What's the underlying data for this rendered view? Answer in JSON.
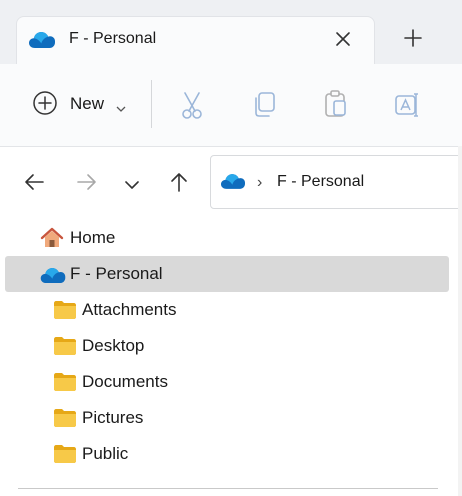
{
  "tab": {
    "title": "F - Personal",
    "cloud_icon": "onedrive-cloud-icon",
    "close_icon": "close-icon"
  },
  "newtab": {
    "icon": "plus-icon"
  },
  "toolbar": {
    "new_label": "New",
    "new_icon": "add-circle-icon",
    "icons": [
      "cut-icon",
      "copy-icon",
      "paste-icon",
      "rename-icon"
    ]
  },
  "nav": {
    "back_icon": "back-arrow-icon",
    "forward_icon": "forward-arrow-icon",
    "recent_icon": "chevron-down-icon",
    "up_icon": "up-arrow-icon"
  },
  "address": {
    "separator": "›",
    "location": "F - Personal"
  },
  "tree": {
    "home": "Home",
    "personal": "F - Personal",
    "folders": [
      "Attachments",
      "Desktop",
      "Documents",
      "Pictures",
      "Public"
    ]
  },
  "colors": {
    "onedrive_blue": "#0f6cbd",
    "folder_yellow": "#f7c948",
    "selection": "#d9d9d9"
  }
}
